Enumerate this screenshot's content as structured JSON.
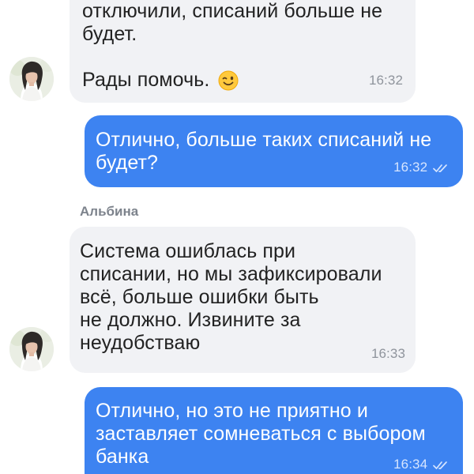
{
  "messages": [
    {
      "direction": "incoming",
      "lines": [
        "отключили, списаний больше не",
        "будет.",
        "",
        "Рады помочь."
      ],
      "emoji": "winking-face",
      "time": "16:32"
    },
    {
      "direction": "outgoing",
      "lines": [
        "Отлично, больше таких списаний не",
        "будет?"
      ],
      "time": "16:32",
      "status": "read"
    },
    {
      "direction": "incoming",
      "sender": "Альбина",
      "lines": [
        "Система ошиблась при",
        "списании, но мы зафиксировали",
        "всё, больше ошибки быть",
        "не должно. Извините за",
        "неудобстваю"
      ],
      "time": "16:33"
    },
    {
      "direction": "outgoing",
      "lines": [
        "Отлично, но это не приятно и",
        "заставляет сомневаться с выбором",
        "банка"
      ],
      "time": "16:34",
      "status": "read"
    }
  ],
  "colors": {
    "incoming_bubble": "#f1f2f5",
    "outgoing_bubble": "#3d83f1",
    "incoming_text": "#222222",
    "outgoing_text": "#ffffff",
    "sender_name": "#7d838c"
  }
}
